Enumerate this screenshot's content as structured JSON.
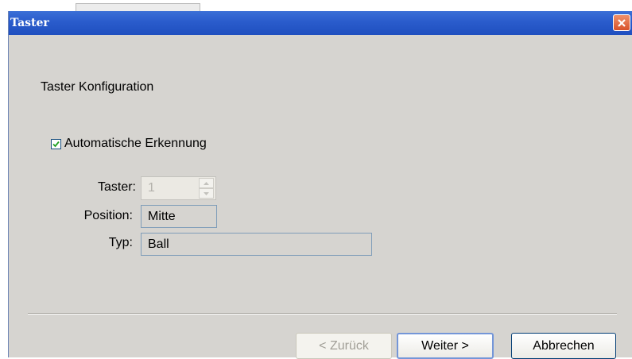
{
  "window": {
    "title": "Taster",
    "close_icon": "close-icon"
  },
  "heading": "Taster Konfiguration",
  "auto_detect": {
    "label": "Automatische Erkennung",
    "checked": true
  },
  "fields": {
    "taster": {
      "label": "Taster:",
      "value": "1",
      "enabled": false
    },
    "position": {
      "label": "Position:",
      "value": "Mitte"
    },
    "typ": {
      "label": "Typ:",
      "value": "Ball"
    }
  },
  "buttons": {
    "back": {
      "label": "< Zurück",
      "enabled": false
    },
    "next": {
      "label": "Weiter >",
      "enabled": true
    },
    "cancel": {
      "label": "Abbrechen",
      "enabled": true
    }
  },
  "colors": {
    "title_bar": "#2a5ccc",
    "close_button": "#d8522b",
    "dialog_background": "#d6d4d0"
  }
}
